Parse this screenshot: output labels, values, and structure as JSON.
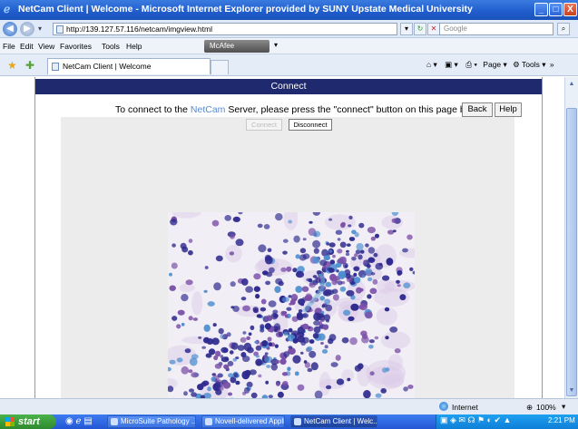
{
  "window": {
    "title": "NetCam Client | Welcome - Microsoft Internet Explorer provided by SUNY Upstate Medical University",
    "minimize_glyph": "_",
    "maximize_glyph": "□",
    "close_glyph": "X"
  },
  "address_bar": {
    "url": "http://139.127.57.116/netcam/imgview.html",
    "search_placeholder": "Google"
  },
  "menu": {
    "items": [
      "File",
      "Edit",
      "View",
      "Favorites",
      "Tools",
      "Help"
    ],
    "mcafee_label": "McAfee"
  },
  "tabs": [
    {
      "label": "NetCam Client | Welcome"
    }
  ],
  "command_bar": {
    "page_label": "Page",
    "tools_label": "Tools"
  },
  "page": {
    "header_title": "Connect",
    "instruction_prefix": "To connect to the ",
    "instruction_brand": "NetCam",
    "instruction_suffix": " Server, please press the \"connect\" button on this page below.",
    "back_label": "Back",
    "help_label": "Help",
    "connect_label": "Connect",
    "disconnect_label": "Disconnect",
    "connect_enabled": false
  },
  "status_bar": {
    "zone_label": "Internet",
    "zoom": "100%"
  },
  "taskbar": {
    "start_label": "start",
    "tasks": [
      {
        "label": "MicroSuite Pathology ...",
        "active": false
      },
      {
        "label": "Novell-delivered Appli...",
        "active": false
      },
      {
        "label": "NetCam Client | Welc...",
        "active": true
      }
    ],
    "clock": "2:21 PM"
  },
  "colors": {
    "connect_header": "#1f2a6e",
    "brand_link": "#5a88d0",
    "stain_dark": "#2e2a8e",
    "stain_purple": "#7b4fa8",
    "stain_blue": "#4e8fd0"
  }
}
